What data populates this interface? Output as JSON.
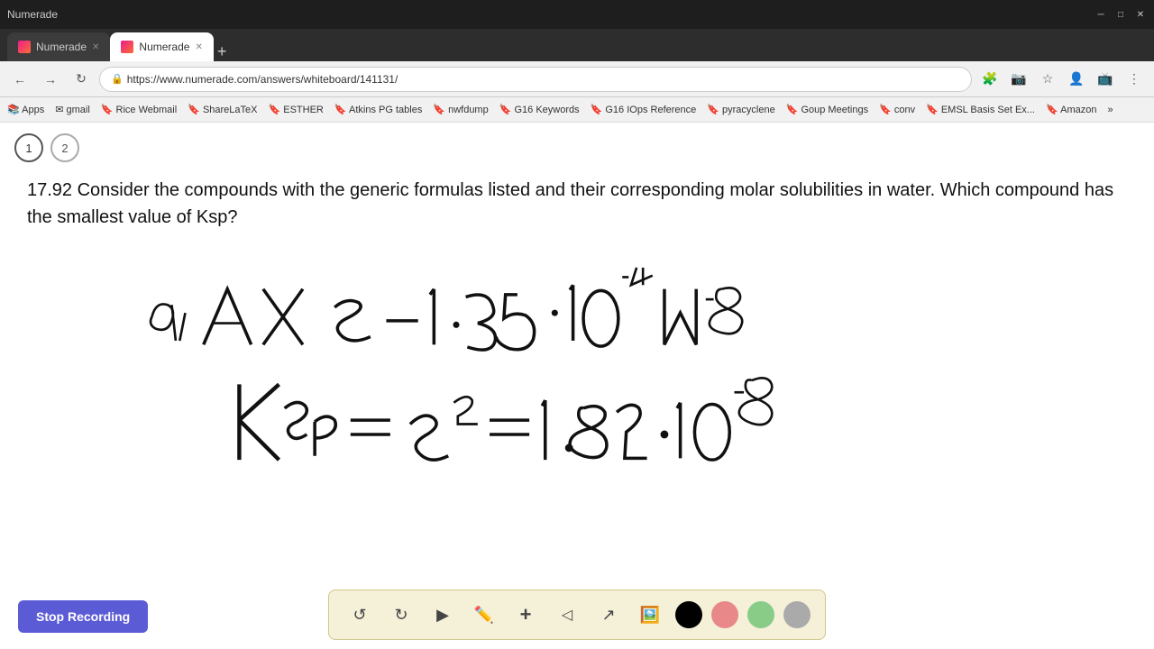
{
  "browser": {
    "title": "Numerade",
    "tabs": [
      {
        "label": "Numerade",
        "active": false
      },
      {
        "label": "Numerade",
        "active": true
      }
    ],
    "url": "https://www.numerade.com/answers/whiteboard/141131/",
    "bookmarks": [
      {
        "label": "Apps"
      },
      {
        "label": "gmail"
      },
      {
        "label": "Rice Webmail"
      },
      {
        "label": "ShareLaTeX"
      },
      {
        "label": "ESTHER"
      },
      {
        "label": "Atkins PG tables"
      },
      {
        "label": "nwfdump"
      },
      {
        "label": "G16 Keywords"
      },
      {
        "label": "G16 IOps Reference"
      },
      {
        "label": "pyracyclene"
      },
      {
        "label": "Goup Meetings"
      },
      {
        "label": "conv"
      },
      {
        "label": "EMSL Basis Set Ex..."
      },
      {
        "label": "Amazon"
      }
    ]
  },
  "page": {
    "question": "17.92 Consider the compounds with the generic formulas listed and their corresponding molar solubilities in water. Which compound has the smallest value of Ksp?",
    "page_numbers": [
      "1",
      "2"
    ],
    "active_page": "1"
  },
  "toolbar": {
    "undo_label": "↺",
    "redo_label": "↻",
    "select_label": "▶",
    "pen_label": "✏",
    "add_label": "+",
    "eraser_label": "◁",
    "arrow_label": "↗",
    "image_label": "🖼",
    "colors": [
      "#000000",
      "#e88888",
      "#88cc88",
      "#aaaaaa"
    ]
  },
  "recording": {
    "button_label": "Stop Recording"
  }
}
